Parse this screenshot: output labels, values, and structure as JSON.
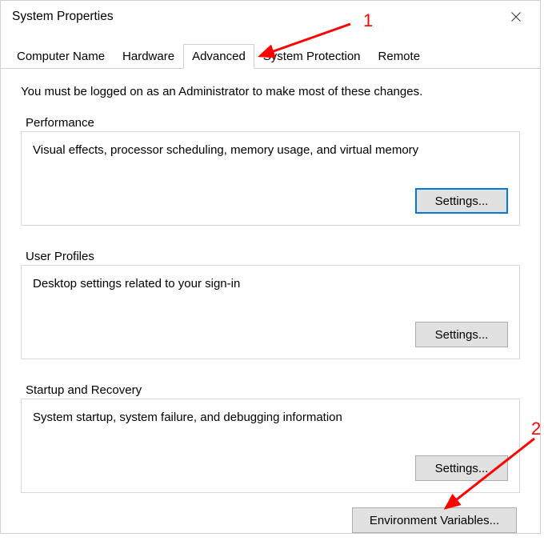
{
  "window": {
    "title": "System Properties"
  },
  "tabs": [
    {
      "label": "Computer Name"
    },
    {
      "label": "Hardware"
    },
    {
      "label": "Advanced"
    },
    {
      "label": "System Protection"
    },
    {
      "label": "Remote"
    }
  ],
  "content": {
    "admin_note": "You must be logged on as an Administrator to make most of these changes.",
    "sections": {
      "performance": {
        "title": "Performance",
        "desc": "Visual effects, processor scheduling, memory usage, and virtual memory",
        "btn": "Settings..."
      },
      "user_profiles": {
        "title": "User Profiles",
        "desc": "Desktop settings related to your sign-in",
        "btn": "Settings..."
      },
      "startup_recovery": {
        "title": "Startup and Recovery",
        "desc": "System startup, system failure, and debugging information",
        "btn": "Settings..."
      }
    },
    "env_btn": "Environment Variables..."
  },
  "annotations": {
    "num1": "1",
    "num2": "2"
  }
}
